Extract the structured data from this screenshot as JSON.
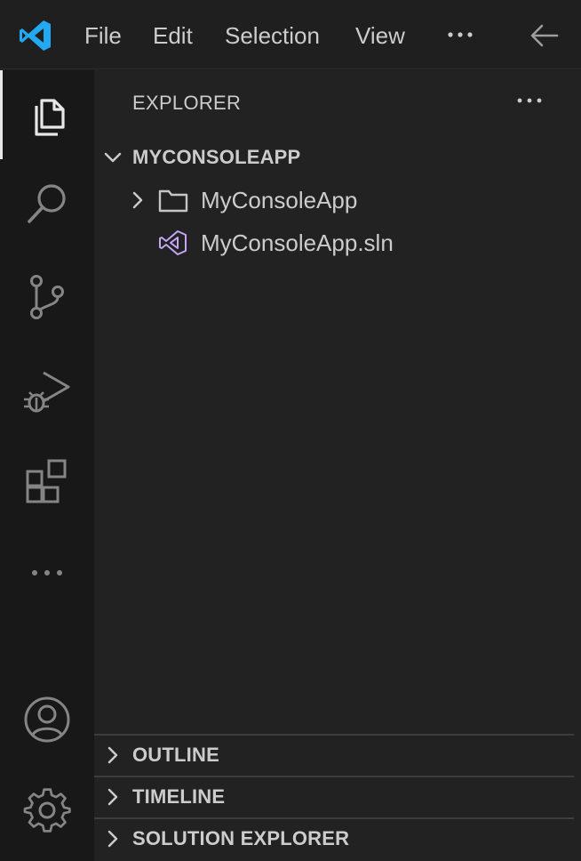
{
  "titlebar": {
    "menu": [
      "File",
      "Edit",
      "Selection",
      "View"
    ]
  },
  "icons": {
    "logo": "vscode-logo-icon",
    "more": "ellipsis-icon",
    "back": "arrow-left-icon"
  },
  "activitybar": {
    "items": [
      {
        "name": "explorer",
        "icon": "files-icon",
        "active": true
      },
      {
        "name": "search",
        "icon": "search-icon",
        "active": false
      },
      {
        "name": "source-control",
        "icon": "source-control-icon",
        "active": false
      },
      {
        "name": "run-debug",
        "icon": "run-debug-icon",
        "active": false
      },
      {
        "name": "extensions",
        "icon": "extensions-icon",
        "active": false
      },
      {
        "name": "more",
        "icon": "ellipsis-icon",
        "active": false
      }
    ],
    "bottom": [
      {
        "name": "accounts",
        "icon": "account-icon"
      },
      {
        "name": "manage",
        "icon": "gear-icon"
      }
    ]
  },
  "sidebar": {
    "title": "EXPLORER",
    "workspace": {
      "label": "MYCONSOLEAPP",
      "items": [
        {
          "label": "MyConsoleApp",
          "kind": "folder"
        },
        {
          "label": "MyConsoleApp.sln",
          "kind": "solution-file"
        }
      ]
    },
    "sections": [
      {
        "label": "OUTLINE"
      },
      {
        "label": "TIMELINE"
      },
      {
        "label": "SOLUTION EXPLORER"
      }
    ]
  },
  "colors": {
    "accent": "#0078d4",
    "logo_blue": "#23a9f2",
    "solution_icon": "#c5a5f5",
    "foreground": "#cccccc",
    "background": "#1f1f1f"
  }
}
